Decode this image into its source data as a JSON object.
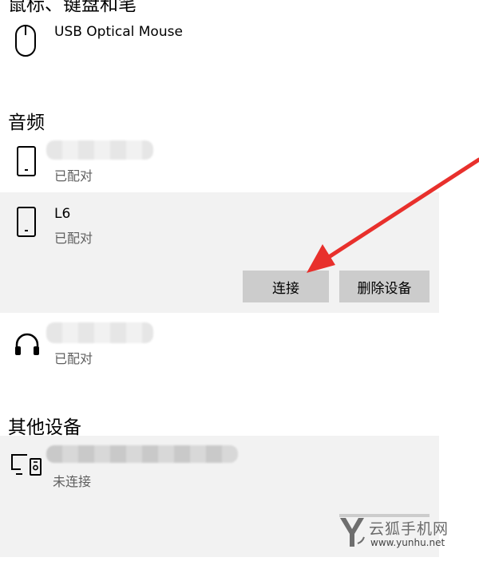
{
  "sections": {
    "mouse_keyboard_pen": {
      "title": "鼠标、键盘和笔"
    },
    "audio": {
      "title": "音频"
    },
    "other_devices": {
      "title": "其他设备"
    }
  },
  "devices": {
    "usb_mouse": {
      "name": "USB Optical Mouse",
      "icon": "mouse-icon"
    },
    "audio_device_1": {
      "name": "",
      "status": "已配对",
      "icon": "phone-icon"
    },
    "l6": {
      "name": "L6",
      "status": "已配对",
      "icon": "phone-icon"
    },
    "audio_device_3": {
      "name": "",
      "status": "已配对",
      "icon": "headphones-icon"
    },
    "other_device_1": {
      "name": "",
      "status": "未连接",
      "icon": "display-device-icon"
    }
  },
  "buttons": {
    "connect": "连接",
    "remove_device": "删除设备"
  },
  "watermark": {
    "brand": "云狐手机网",
    "url": "www.yunhu.net"
  },
  "colors": {
    "arrow": "#e8302c",
    "panel": "#f2f2f2",
    "button": "#cccccc"
  }
}
